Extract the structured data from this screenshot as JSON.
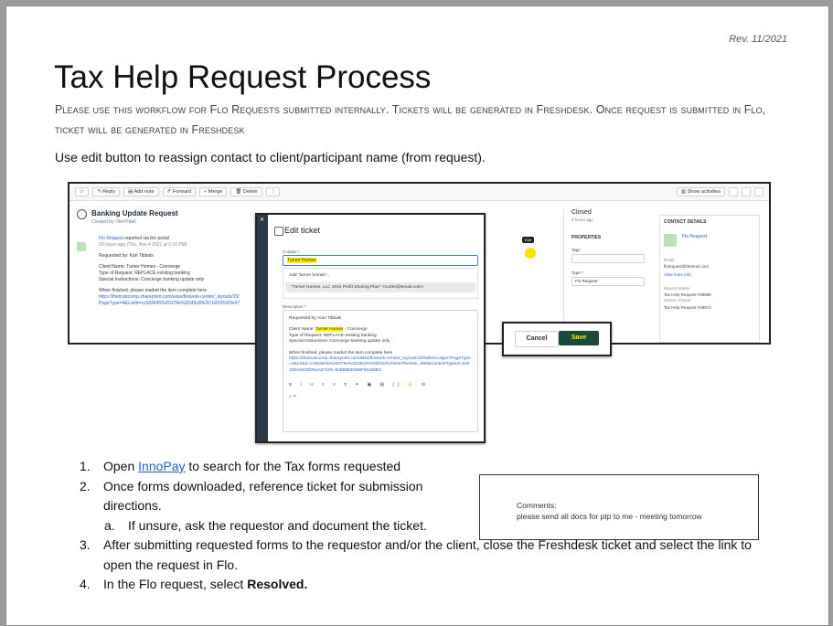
{
  "revision": "Rev. 11/2021",
  "title": "Tax Help Request Process",
  "subtitle": "Please use this workflow for Flo Requests submitted internally. Tickets will be generated in Freshdesk. Once request is submitted in Flo, ticket will be generated in Freshdesk",
  "intro": "Use edit button to reassign contact to client/participant name (from request).",
  "screenshot": {
    "toolbar": [
      "Reply",
      "Add note",
      "Forward",
      "Merge",
      "Delete",
      "Show activities"
    ],
    "ticket_title": "Banking Update Request",
    "created_by": "Created by: Neil Patel",
    "via_portal_link": "Flo Request",
    "via_portal_text": "reported via the portal",
    "time": "20 hours ago (Thu, Nov 4 2021 at 5:16 PM)",
    "requested_by": "Requested by: Kari Tibbals",
    "client_name": "Client Name: Turner Homes - Concierge",
    "type_of_request": "Type of Request: REPLACE existing banking",
    "special_instructions": "Special Instructions: Concierge banking update only",
    "when_finished": "When finished, please market the item complete here",
    "url_line1": "https://thetrustcomp.sharepoint.com/sites/flo/work-center/_layouts/15/",
    "url_line2": "PageType=4&ListId=cc583645%2D379e%2D45c8%2D b253%2De97",
    "edit_tooltip": "Edit",
    "status": "Closed",
    "status_time": "2 hours ago",
    "properties_label": "PROPERTIES",
    "tags_label": "Tags",
    "type_label": "Type *",
    "type_value": "Flo Request",
    "contact_details_label": "CONTACT DETAILS",
    "contact_name": "Flo Request",
    "email_label": "Email",
    "email_value": "florequest@thetrust.com",
    "view_more": "View more info",
    "recent_tickets": "Recent tickets",
    "recent_1": "Tax Help Request #49586",
    "recent_1_status": "Status: Closed",
    "recent_2": "Tax Help Request #49574"
  },
  "modal": {
    "title": "Edit ticket",
    "contact_label": "Contact *",
    "contact_value": "Turner Homes",
    "add_option": "Add \"turner homes\"...",
    "match_option": "\"Turner Homes, LLC 401k Profit Sharing Plan\" <no294@email.com>",
    "description_label": "Description *",
    "desc_requested_by": "Requested by: Kari Tibbals",
    "desc_client_prefix": "Client Name:",
    "desc_client_highlight": "Turner Homes",
    "desc_client_suffix": "- Concierge",
    "desc_type": "Type of Request: REPLACE existing banking",
    "desc_special": "Special Instructions: Concierge banking update only",
    "desc_when": "When finished, please market the item complete here",
    "desc_url": "https://thetrustcomp.sharepoint.com/sites/flo/work-center/_layouts/15/listform.aspx?PageType=4&ListId=cc583645%2D379e%2D45c8%2Db253%2De97f5e346...698&ContentTypeID=0x0100ADC92051A57426 4CB98DD368F91108EC",
    "cancel_label": "Cancel",
    "save_label": "Save"
  },
  "steps": [
    {
      "num": "1.",
      "before": "Open ",
      "link": "InnoPay",
      "after": " to search for the Tax forms requested"
    },
    {
      "num": "2.",
      "text": "Once forms downloaded, reference ticket for submission directions."
    },
    {
      "num": "a.",
      "text": "If unsure, ask the requestor and document the ticket."
    },
    {
      "num": "3.",
      "text": "After submitting requested forms to the requestor and/or the client, close the Freshdesk ticket and select the link to open the request in Flo."
    },
    {
      "num": "4.",
      "before": "In the Flo request, select ",
      "bold": "Resolved."
    }
  ],
  "comments": {
    "label": "Comments:",
    "value": "please send all docs for ptp to me - meeting tomorrow"
  }
}
